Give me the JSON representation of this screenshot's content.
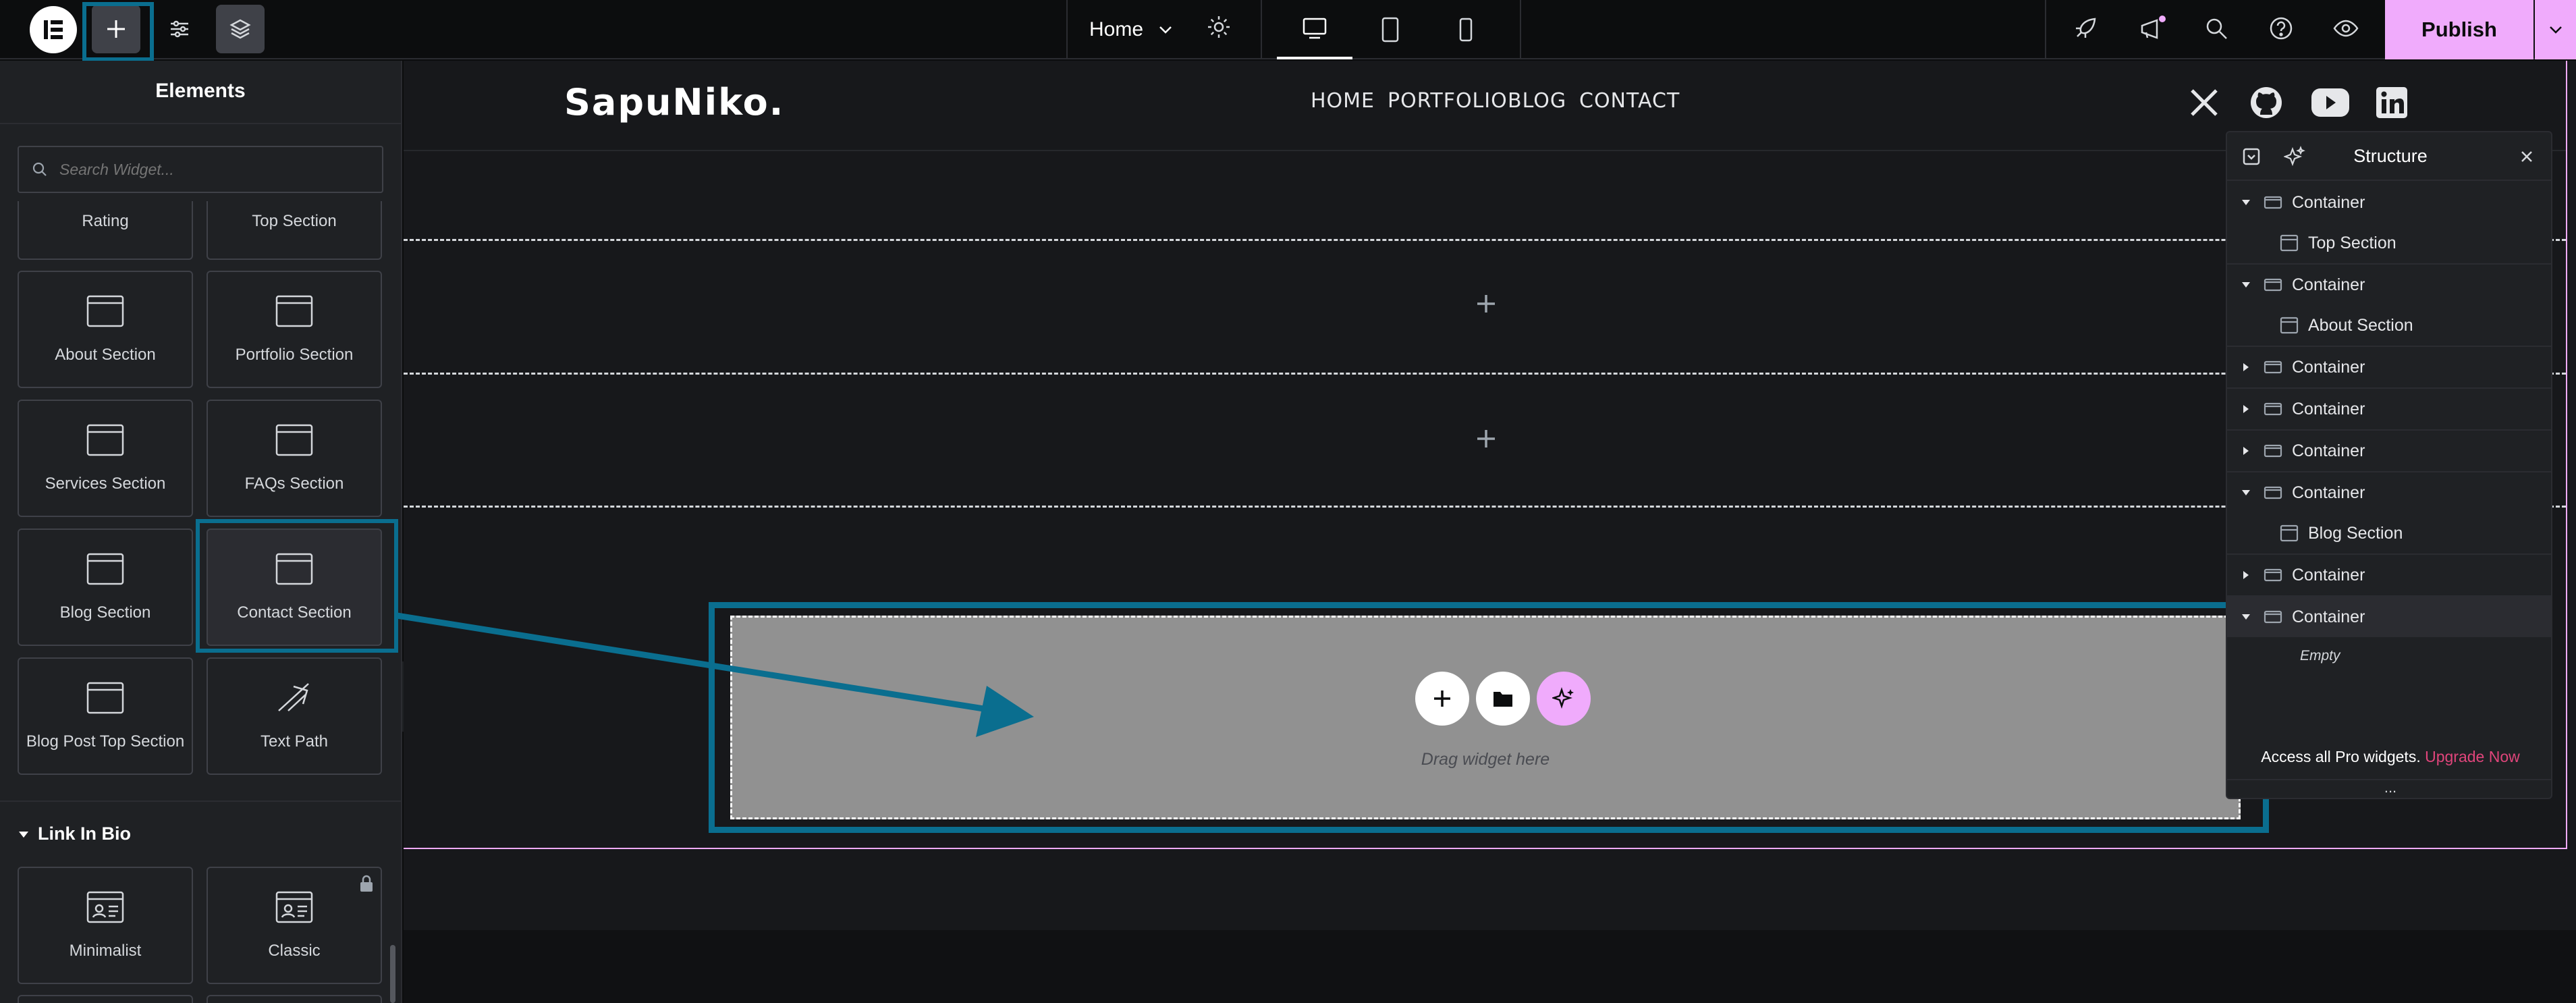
{
  "topbar": {
    "logo_icon": "elementor-logo",
    "add_icon": "plus-icon",
    "settings_icon": "sliders-icon",
    "structure_icon": "layers-icon",
    "page_name": "Home",
    "devices": [
      "desktop-icon",
      "tablet-icon",
      "mobile-icon"
    ],
    "right_icons": [
      "rocket-icon",
      "megaphone-icon",
      "search-icon",
      "help-icon",
      "eye-icon"
    ],
    "publish_label": "Publish",
    "colors": {
      "publish_bg": "#f0abfc",
      "accent": "#0a6e8f"
    }
  },
  "sidebar": {
    "title": "Elements",
    "search_placeholder": "Search Widget...",
    "widgets": [
      "Rating",
      "Top Section",
      "About Section",
      "Portfolio Section",
      "Services Section",
      "FAQs Section",
      "Blog Section",
      "Contact Section",
      "Blog Post Top Section",
      "Text Path"
    ],
    "link_in_bio": {
      "heading": "Link In Bio",
      "items": [
        "Minimalist",
        "Classic"
      ]
    }
  },
  "site": {
    "logo": "SapuNiko.",
    "nav": [
      "HOME",
      "PORTFOLIO",
      "BLOG",
      "CONTACT"
    ],
    "social": [
      "x-icon",
      "github-icon",
      "youtube-icon",
      "linkedin-icon"
    ]
  },
  "dropzone": {
    "hint": "Drag widget here"
  },
  "structure": {
    "title": "Structure",
    "rows": [
      {
        "label": "Container",
        "state": "expanded"
      },
      {
        "label": "Top Section",
        "state": "child"
      },
      {
        "label": "Container",
        "state": "expanded"
      },
      {
        "label": "About Section",
        "state": "child"
      },
      {
        "label": "Container",
        "state": "collapsed"
      },
      {
        "label": "Container",
        "state": "collapsed"
      },
      {
        "label": "Container",
        "state": "collapsed"
      },
      {
        "label": "Container",
        "state": "expanded"
      },
      {
        "label": "Blog Section",
        "state": "child"
      },
      {
        "label": "Container",
        "state": "collapsed"
      },
      {
        "label": "Container",
        "state": "expanded-selected"
      }
    ],
    "empty_label": "Empty",
    "promo_text": "Access all Pro widgets.",
    "promo_link": "Upgrade Now",
    "more_label": "..."
  }
}
